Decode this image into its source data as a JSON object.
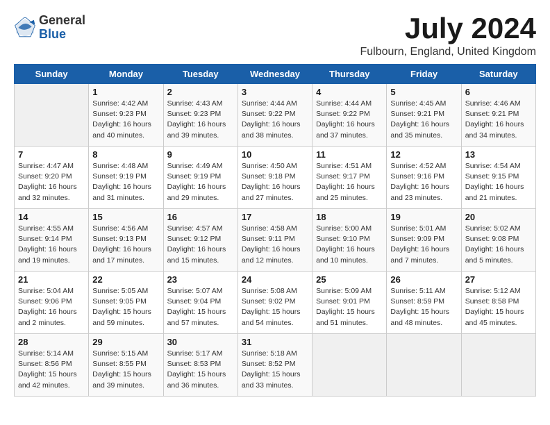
{
  "logo": {
    "general": "General",
    "blue": "Blue"
  },
  "title": "July 2024",
  "location": "Fulbourn, England, United Kingdom",
  "days_of_week": [
    "Sunday",
    "Monday",
    "Tuesday",
    "Wednesday",
    "Thursday",
    "Friday",
    "Saturday"
  ],
  "weeks": [
    [
      {
        "day": "",
        "info": ""
      },
      {
        "day": "1",
        "info": "Sunrise: 4:42 AM\nSunset: 9:23 PM\nDaylight: 16 hours\nand 40 minutes."
      },
      {
        "day": "2",
        "info": "Sunrise: 4:43 AM\nSunset: 9:23 PM\nDaylight: 16 hours\nand 39 minutes."
      },
      {
        "day": "3",
        "info": "Sunrise: 4:44 AM\nSunset: 9:22 PM\nDaylight: 16 hours\nand 38 minutes."
      },
      {
        "day": "4",
        "info": "Sunrise: 4:44 AM\nSunset: 9:22 PM\nDaylight: 16 hours\nand 37 minutes."
      },
      {
        "day": "5",
        "info": "Sunrise: 4:45 AM\nSunset: 9:21 PM\nDaylight: 16 hours\nand 35 minutes."
      },
      {
        "day": "6",
        "info": "Sunrise: 4:46 AM\nSunset: 9:21 PM\nDaylight: 16 hours\nand 34 minutes."
      }
    ],
    [
      {
        "day": "7",
        "info": "Sunrise: 4:47 AM\nSunset: 9:20 PM\nDaylight: 16 hours\nand 32 minutes."
      },
      {
        "day": "8",
        "info": "Sunrise: 4:48 AM\nSunset: 9:19 PM\nDaylight: 16 hours\nand 31 minutes."
      },
      {
        "day": "9",
        "info": "Sunrise: 4:49 AM\nSunset: 9:19 PM\nDaylight: 16 hours\nand 29 minutes."
      },
      {
        "day": "10",
        "info": "Sunrise: 4:50 AM\nSunset: 9:18 PM\nDaylight: 16 hours\nand 27 minutes."
      },
      {
        "day": "11",
        "info": "Sunrise: 4:51 AM\nSunset: 9:17 PM\nDaylight: 16 hours\nand 25 minutes."
      },
      {
        "day": "12",
        "info": "Sunrise: 4:52 AM\nSunset: 9:16 PM\nDaylight: 16 hours\nand 23 minutes."
      },
      {
        "day": "13",
        "info": "Sunrise: 4:54 AM\nSunset: 9:15 PM\nDaylight: 16 hours\nand 21 minutes."
      }
    ],
    [
      {
        "day": "14",
        "info": "Sunrise: 4:55 AM\nSunset: 9:14 PM\nDaylight: 16 hours\nand 19 minutes."
      },
      {
        "day": "15",
        "info": "Sunrise: 4:56 AM\nSunset: 9:13 PM\nDaylight: 16 hours\nand 17 minutes."
      },
      {
        "day": "16",
        "info": "Sunrise: 4:57 AM\nSunset: 9:12 PM\nDaylight: 16 hours\nand 15 minutes."
      },
      {
        "day": "17",
        "info": "Sunrise: 4:58 AM\nSunset: 9:11 PM\nDaylight: 16 hours\nand 12 minutes."
      },
      {
        "day": "18",
        "info": "Sunrise: 5:00 AM\nSunset: 9:10 PM\nDaylight: 16 hours\nand 10 minutes."
      },
      {
        "day": "19",
        "info": "Sunrise: 5:01 AM\nSunset: 9:09 PM\nDaylight: 16 hours\nand 7 minutes."
      },
      {
        "day": "20",
        "info": "Sunrise: 5:02 AM\nSunset: 9:08 PM\nDaylight: 16 hours\nand 5 minutes."
      }
    ],
    [
      {
        "day": "21",
        "info": "Sunrise: 5:04 AM\nSunset: 9:06 PM\nDaylight: 16 hours\nand 2 minutes."
      },
      {
        "day": "22",
        "info": "Sunrise: 5:05 AM\nSunset: 9:05 PM\nDaylight: 15 hours\nand 59 minutes."
      },
      {
        "day": "23",
        "info": "Sunrise: 5:07 AM\nSunset: 9:04 PM\nDaylight: 15 hours\nand 57 minutes."
      },
      {
        "day": "24",
        "info": "Sunrise: 5:08 AM\nSunset: 9:02 PM\nDaylight: 15 hours\nand 54 minutes."
      },
      {
        "day": "25",
        "info": "Sunrise: 5:09 AM\nSunset: 9:01 PM\nDaylight: 15 hours\nand 51 minutes."
      },
      {
        "day": "26",
        "info": "Sunrise: 5:11 AM\nSunset: 8:59 PM\nDaylight: 15 hours\nand 48 minutes."
      },
      {
        "day": "27",
        "info": "Sunrise: 5:12 AM\nSunset: 8:58 PM\nDaylight: 15 hours\nand 45 minutes."
      }
    ],
    [
      {
        "day": "28",
        "info": "Sunrise: 5:14 AM\nSunset: 8:56 PM\nDaylight: 15 hours\nand 42 minutes."
      },
      {
        "day": "29",
        "info": "Sunrise: 5:15 AM\nSunset: 8:55 PM\nDaylight: 15 hours\nand 39 minutes."
      },
      {
        "day": "30",
        "info": "Sunrise: 5:17 AM\nSunset: 8:53 PM\nDaylight: 15 hours\nand 36 minutes."
      },
      {
        "day": "31",
        "info": "Sunrise: 5:18 AM\nSunset: 8:52 PM\nDaylight: 15 hours\nand 33 minutes."
      },
      {
        "day": "",
        "info": ""
      },
      {
        "day": "",
        "info": ""
      },
      {
        "day": "",
        "info": ""
      }
    ]
  ]
}
